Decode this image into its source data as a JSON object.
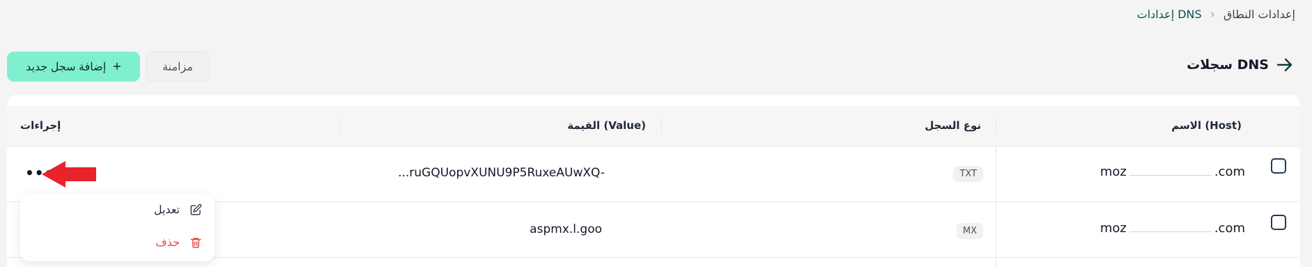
{
  "breadcrumb": {
    "parent": "إعدادات النطاق",
    "separator": "›",
    "current": "إعدادات DNS"
  },
  "header": {
    "title": "سجلات DNS",
    "back_icon": "arrow-right-icon",
    "add_button": "إضافة سجل جديد",
    "add_icon": "+",
    "sync_button": "مزامنة"
  },
  "table": {
    "columns": {
      "host": "الاسم (Host)",
      "type": "نوع السجل",
      "value": "القيمة (Value)",
      "actions": "إجراءات"
    },
    "rows": [
      {
        "host_prefix": "moz",
        "host_suffix": ".com",
        "type": "TXT",
        "value": "...ruGQUopvXUNU9P5RuxeAUwXQ-"
      },
      {
        "host_prefix": "moz",
        "host_suffix": ".com",
        "type": "MX",
        "value": "aspmx.l.goo"
      }
    ],
    "actions_icon": "•••"
  },
  "action_menu": {
    "edit": "تعديل",
    "delete": "حذف"
  },
  "colors": {
    "accent": "#7ff0cf",
    "danger": "#ef4444",
    "annotation_arrow": "#e8232b"
  }
}
